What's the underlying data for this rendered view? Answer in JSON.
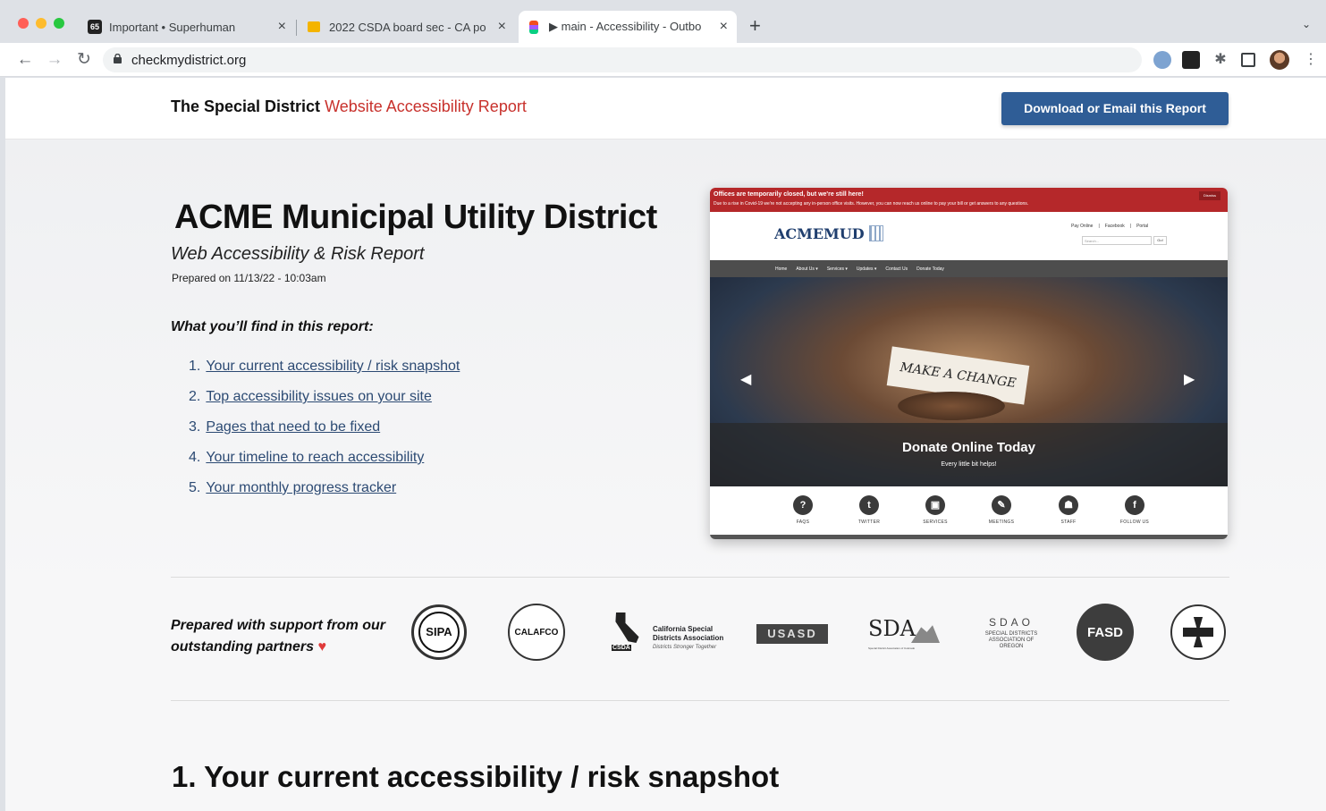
{
  "browser": {
    "tabs": [
      {
        "badge": "65",
        "title": "Important • Superhuman"
      },
      {
        "title": "2022 CSDA board sec - CA po"
      },
      {
        "title": "▶ main - Accessibility - Outbo"
      }
    ],
    "new_tab": "+",
    "url": "checkmydistrict.org",
    "traffic_colors": [
      "#ff5f57",
      "#febc2e",
      "#28c840"
    ]
  },
  "header": {
    "brand_bold": "The Special District",
    "brand_accent": "Website Accessibility Report",
    "cta_label": "Download or Email this Report",
    "accent_color": "#c8312c",
    "cta_color": "#2f5d96"
  },
  "hero": {
    "title": "ACME Municipal Utility District",
    "subtitle": "Web Accessibility & Risk Report",
    "prepared": "Prepared on 11/13/22 - 10:03am",
    "find_title": "What you’ll find in this report:",
    "toc": [
      {
        "num": "1.",
        "label": "Your current accessibility / risk snapshot"
      },
      {
        "num": "2.",
        "label": "Top accessibility issues on your site"
      },
      {
        "num": "3.",
        "label": "Pages that need to be fixed"
      },
      {
        "num": "4.",
        "label": "Your timeline to reach accessibility"
      },
      {
        "num": "5.",
        "label": "Your monthly progress tracker"
      }
    ]
  },
  "preview": {
    "alert_title": "Offices are temporarily closed, but we're still here!",
    "alert_text": "Due to a rise in Covid-19 we're not accepting any in-person office visits. However, you can now reach us online to pay your bill or get answers to any questions.",
    "dismiss": "Dismiss",
    "logo": "ACMEMUD",
    "top_links": [
      "Pay Online",
      "Facebook",
      "Portal"
    ],
    "search_placeholder": "Search...",
    "go": "Go!",
    "nav": [
      "Home",
      "About Us ▾",
      "Services ▾",
      "Updates ▾",
      "Contact Us",
      "Donate Today"
    ],
    "paper_text": "MAKE A CHANGE",
    "slide_title": "Donate Online Today",
    "slide_sub": "Every little bit helps!",
    "icons": [
      {
        "glyph": "?",
        "label": "FAQS"
      },
      {
        "glyph": "t",
        "label": "TWITTER"
      },
      {
        "glyph": "▣",
        "label": "SERVICES"
      },
      {
        "glyph": "✎",
        "label": "MEETINGS"
      },
      {
        "glyph": "☗",
        "label": "STAFF"
      },
      {
        "glyph": "f",
        "label": "FOLLOW US"
      }
    ]
  },
  "partners": {
    "label": "Prepared with support from our outstanding partners",
    "heart": "♥",
    "logos": [
      "SIPA",
      "CALAFCO",
      "California Special Districts Association",
      "Districts Stronger Together",
      "CSDA",
      "USASD",
      "SDA",
      "Special District Association of Colorado",
      "SDAO",
      "SPECIAL DISTRICTS ASSOCIATION OF OREGON",
      "FASD"
    ]
  },
  "section1": {
    "title": "1. Your current accessibility / risk snapshot"
  }
}
